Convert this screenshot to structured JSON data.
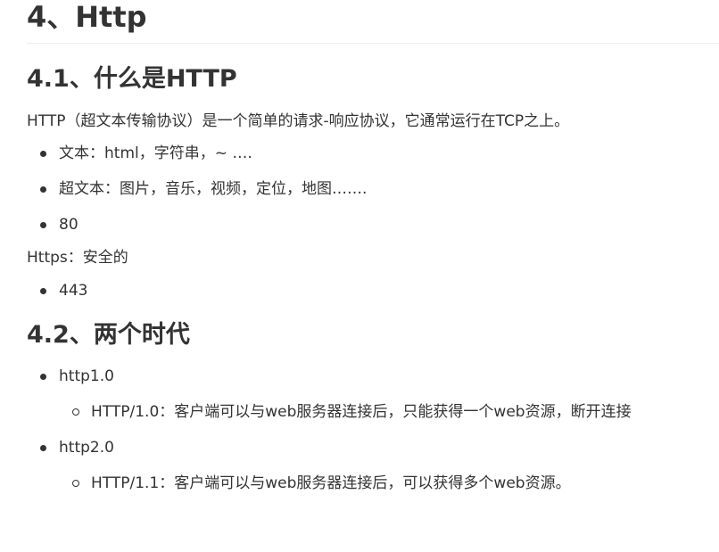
{
  "heading_main": "4、Http",
  "section1": {
    "heading": "4.1、什么是HTTP",
    "intro": "HTTP（超文本传输协议）是一个简单的请求-响应协议，它通常运行在TCP之上。",
    "items": [
      "文本：html，字符串，~ ….",
      "超文本：图片，音乐，视频，定位，地图…….",
      "80"
    ],
    "https_label": "Https：安全的",
    "https_items": [
      "443"
    ]
  },
  "section2": {
    "heading": "4.2、两个时代",
    "items": [
      {
        "label": "http1.0",
        "sub": [
          "HTTP/1.0：客户端可以与web服务器连接后，只能获得一个web资源，断开连接"
        ]
      },
      {
        "label": "http2.0",
        "sub": [
          "HTTP/1.1：客户端可以与web服务器连接后，可以获得多个web资源。"
        ]
      }
    ]
  }
}
